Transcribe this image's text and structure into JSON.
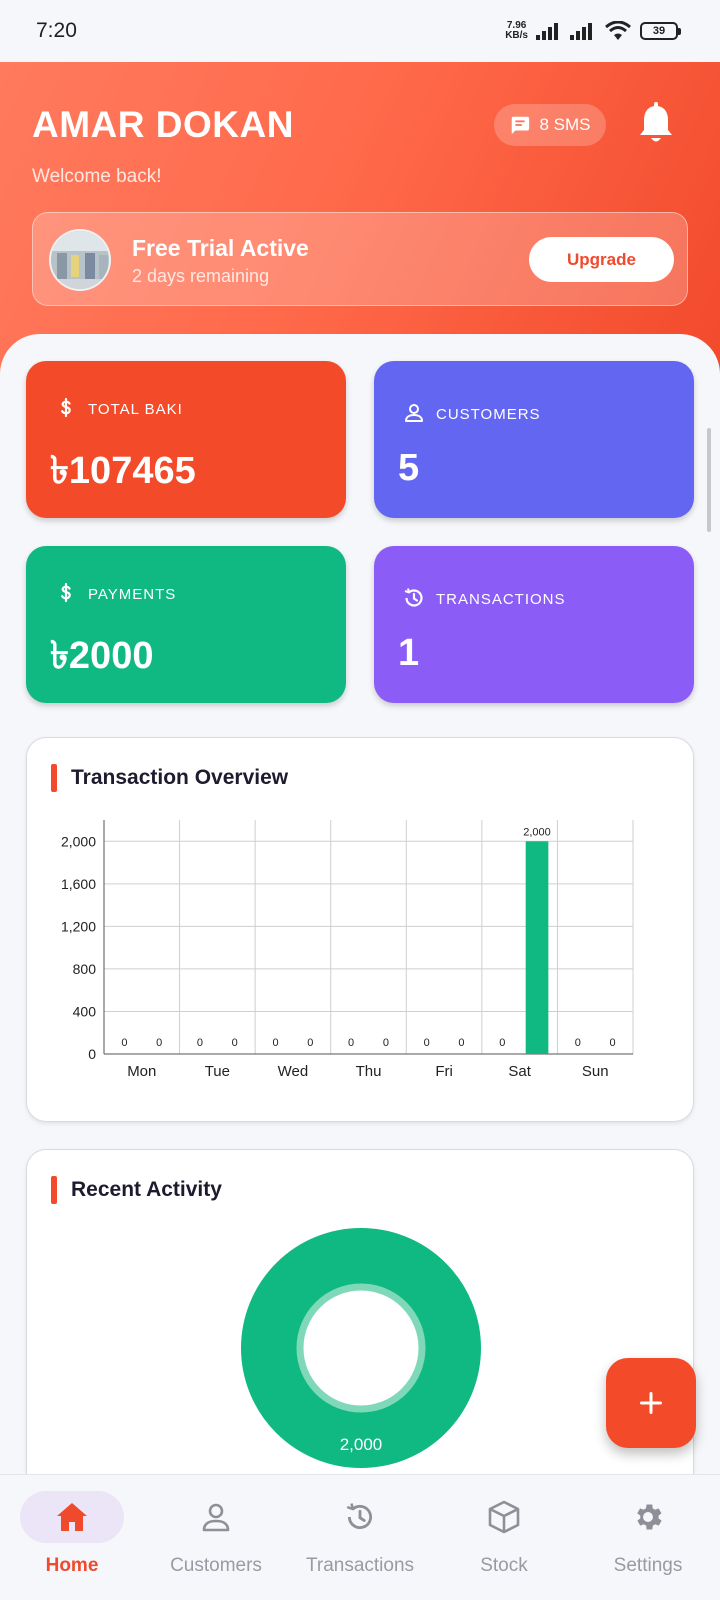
{
  "status_bar": {
    "time": "7:20",
    "net_speed_value": "7.96",
    "net_speed_unit": "KB/s",
    "battery": "39"
  },
  "header": {
    "title": "AMAR DOKAN",
    "subtitle": "Welcome back!",
    "sms_label": "8 SMS",
    "trial": {
      "title": "Free Trial Active",
      "remaining": "2 days remaining",
      "upgrade_label": "Upgrade"
    }
  },
  "stats": {
    "total_baki": {
      "label": "TOTAL BAKI",
      "value": "৳107465",
      "color": "#f34a29",
      "icon": "dollar-icon"
    },
    "customers": {
      "label": "CUSTOMERS",
      "value": "5",
      "color": "#6366f1",
      "icon": "person-icon"
    },
    "payments": {
      "label": "PAYMENTS",
      "value": "৳2000",
      "color": "#10b981",
      "icon": "dollar-icon"
    },
    "transactions": {
      "label": "TRANSACTIONS",
      "value": "1",
      "color": "#8b5cf6",
      "icon": "history-icon"
    }
  },
  "overview": {
    "title": "Transaction Overview"
  },
  "activity": {
    "title": "Recent Activity"
  },
  "chart_data": [
    {
      "type": "bar",
      "title": "Transaction Overview",
      "categories": [
        "Mon",
        "Tue",
        "Wed",
        "Thu",
        "Fri",
        "Sat",
        "Sun"
      ],
      "series": [
        {
          "values": [
            0,
            0,
            0,
            0,
            0,
            0,
            0
          ],
          "color": "#10b981"
        },
        {
          "values": [
            0,
            0,
            0,
            0,
            0,
            2000,
            0
          ],
          "color": "#10b981"
        }
      ],
      "yticks": [
        "0",
        "400",
        "800",
        "1,200",
        "1,600",
        "2,000"
      ],
      "ylim": [
        0,
        2200
      ],
      "grid": true
    },
    {
      "type": "pie",
      "title": "Recent Activity",
      "values": [
        2000
      ],
      "value_labels": [
        "2,000"
      ],
      "colors": [
        "#10b981"
      ]
    }
  ],
  "nav": {
    "items": [
      {
        "label": "Home",
        "icon": "home-icon",
        "active": true
      },
      {
        "label": "Customers",
        "icon": "person-icon",
        "active": false
      },
      {
        "label": "Transactions",
        "icon": "history-icon",
        "active": false
      },
      {
        "label": "Stock",
        "icon": "box-icon",
        "active": false
      },
      {
        "label": "Settings",
        "icon": "gear-icon",
        "active": false
      }
    ]
  },
  "colors": {
    "accent": "#f34a29",
    "nav_active_bg": "#ebe5f7",
    "nav_inactive": "#9a9aa3"
  }
}
